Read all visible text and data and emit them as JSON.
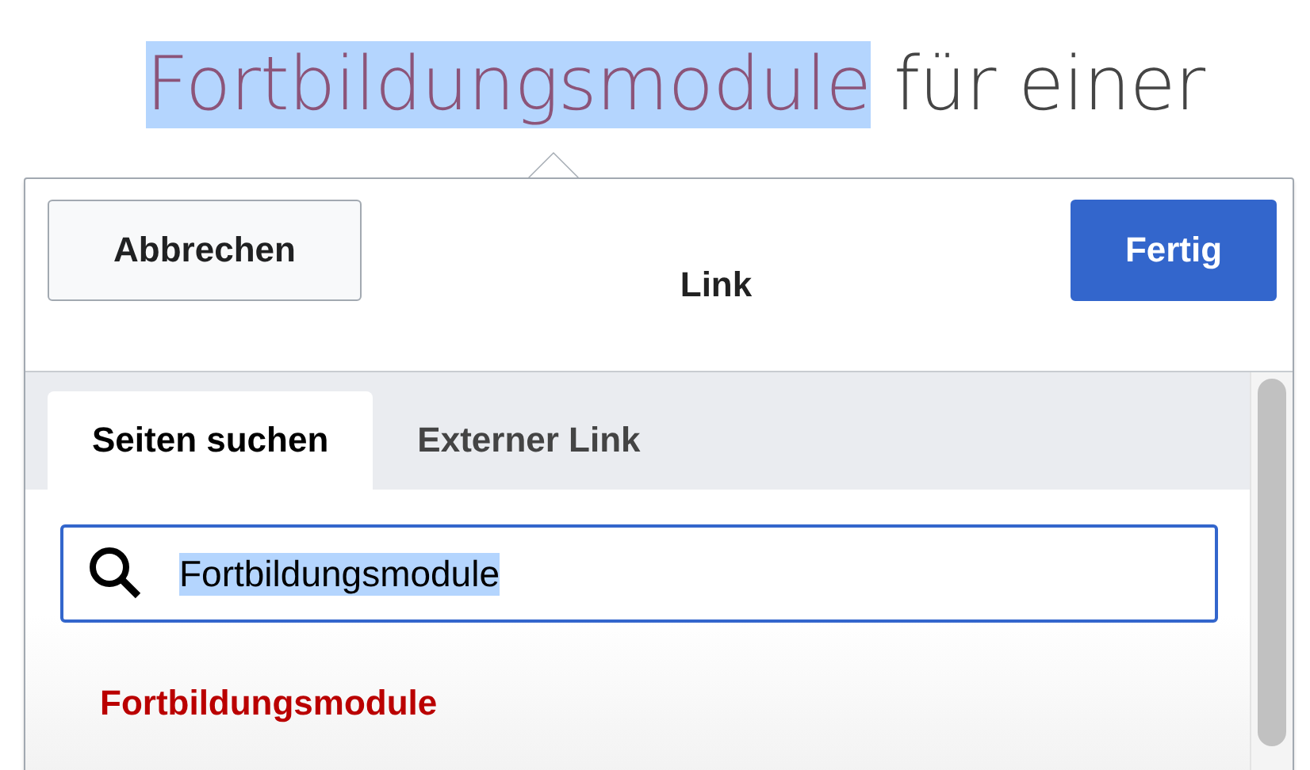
{
  "heading": {
    "link_text": "Fortbildungsmodule",
    "link_selected": true,
    "rest": "für einer"
  },
  "dialog": {
    "cancel_button": "Abbrechen",
    "title": "Link",
    "done_button": "Fertig",
    "tabs": [
      {
        "label": "Seiten suchen",
        "selected": true
      },
      {
        "label": "Externer Link",
        "selected": false
      }
    ],
    "search": {
      "value": "Fortbildungsmodule",
      "value_selected": true
    },
    "results": [
      {
        "title": "Fortbildungsmodule",
        "missing": true
      }
    ]
  }
}
